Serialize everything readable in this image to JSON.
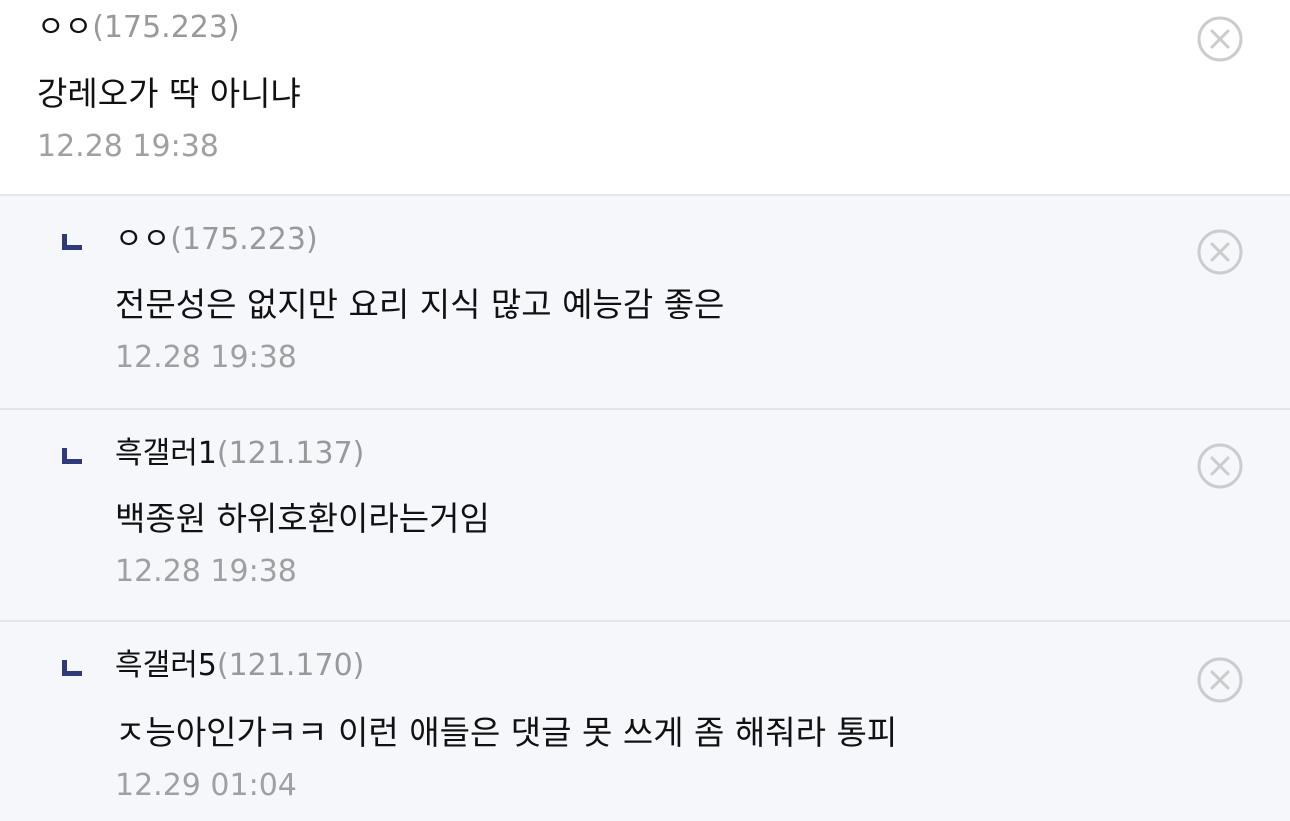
{
  "comments": [
    {
      "author": "ㅇㅇ",
      "ip": "(175.223)",
      "text": "강레오가 딱 아니냐",
      "time": "12.28 19:38",
      "is_reply": false
    },
    {
      "author": "ㅇㅇ",
      "ip": "(175.223)",
      "text": "전문성은 없지만 요리 지식 많고 예능감 좋은",
      "time": "12.28 19:38",
      "is_reply": true
    },
    {
      "author": "흑갤러1",
      "ip": "(121.137)",
      "text": "백종원 하위호환이라는거임",
      "time": "12.28 19:38",
      "is_reply": true
    },
    {
      "author": "흑갤러5",
      "ip": "(121.170)",
      "text": "ㅈ능아인가ㅋㅋ 이런 애들은 댓글 못 쓰게 좀 해줘라 통피",
      "time": "12.29 01:04",
      "is_reply": true
    }
  ],
  "icons": {
    "reply": "reply-arrow-icon",
    "delete": "close-circle-icon"
  },
  "colors": {
    "reply_icon": "#2f3a7a",
    "reply_background": "#f6f7fb",
    "divider": "#e3e5ee",
    "ip_text": "#999999",
    "timestamp": "#a0a0a0",
    "delete_icon": "#cccccc"
  }
}
